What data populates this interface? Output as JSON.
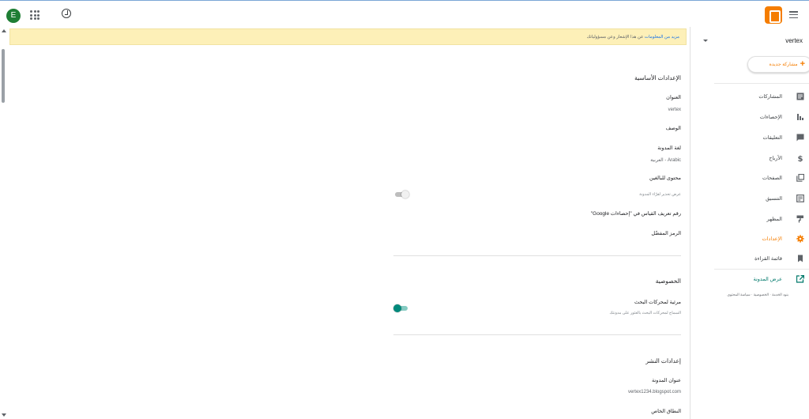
{
  "topbar": {
    "avatar_letter": "E",
    "apps_icon": "apps-grid-icon",
    "help_icon": "help-circle-icon",
    "logo_icon": "blogger-logo",
    "menu_icon": "hamburger-icon"
  },
  "banner": {
    "link": "مزيد من المعلومات",
    "text": "عن هذا الإشعار وعن مسؤولياتك"
  },
  "sidebar": {
    "blog_name": "vertex",
    "new_post": "مشاركة جديدة",
    "items": [
      {
        "label": "المشاركات",
        "icon": "posts-icon"
      },
      {
        "label": "الإحصاءات",
        "icon": "stats-icon"
      },
      {
        "label": "التعليقات",
        "icon": "comments-icon"
      },
      {
        "label": "الأرباح",
        "icon": "dollar-icon"
      },
      {
        "label": "الصفحات",
        "icon": "pages-icon"
      },
      {
        "label": "التنسيق",
        "icon": "layout-icon"
      },
      {
        "label": "المظهر",
        "icon": "paint-roller-icon"
      },
      {
        "label": "الإعدادات",
        "icon": "gear-icon"
      },
      {
        "label": "قائمة القراءة",
        "icon": "bookmark-icon"
      }
    ],
    "view_blog": "عرض المدونة",
    "footer": {
      "terms": "بنود الخدمة",
      "privacy": "الخصوصية",
      "content_policy": "سياسة المحتوى",
      "sep": "·"
    },
    "accent_color": "#f57d00"
  },
  "settings": {
    "basic": {
      "title": "الإعدادات الأساسية",
      "title_label": "العنوان",
      "title_value": "vertex",
      "description_label": "الوصف",
      "language_label": "لغة المدونة",
      "language_value": "Arabic - العربية",
      "adult_label": "محتوى للبالغين",
      "adult_hint": "عرض تحذير لقرّاء المدونة",
      "adult_toggle": false,
      "analytics_label": "رقم تعريف القياس في \"إحصاءات Google\"",
      "favicon_label": "الرمز المفضّل"
    },
    "privacy": {
      "title": "الخصوصية",
      "search_label": "مرئية لمحركات البحث",
      "search_hint": "السماح لمحركات البحث بالعثور على مدونتك",
      "search_toggle": true
    },
    "publishing": {
      "title": "إعدادات النشر",
      "address_label": "عنوان المدونة",
      "address_value": "vertex1234.blogspot.com",
      "custom_domain_label": "النطاق الخاص"
    }
  }
}
